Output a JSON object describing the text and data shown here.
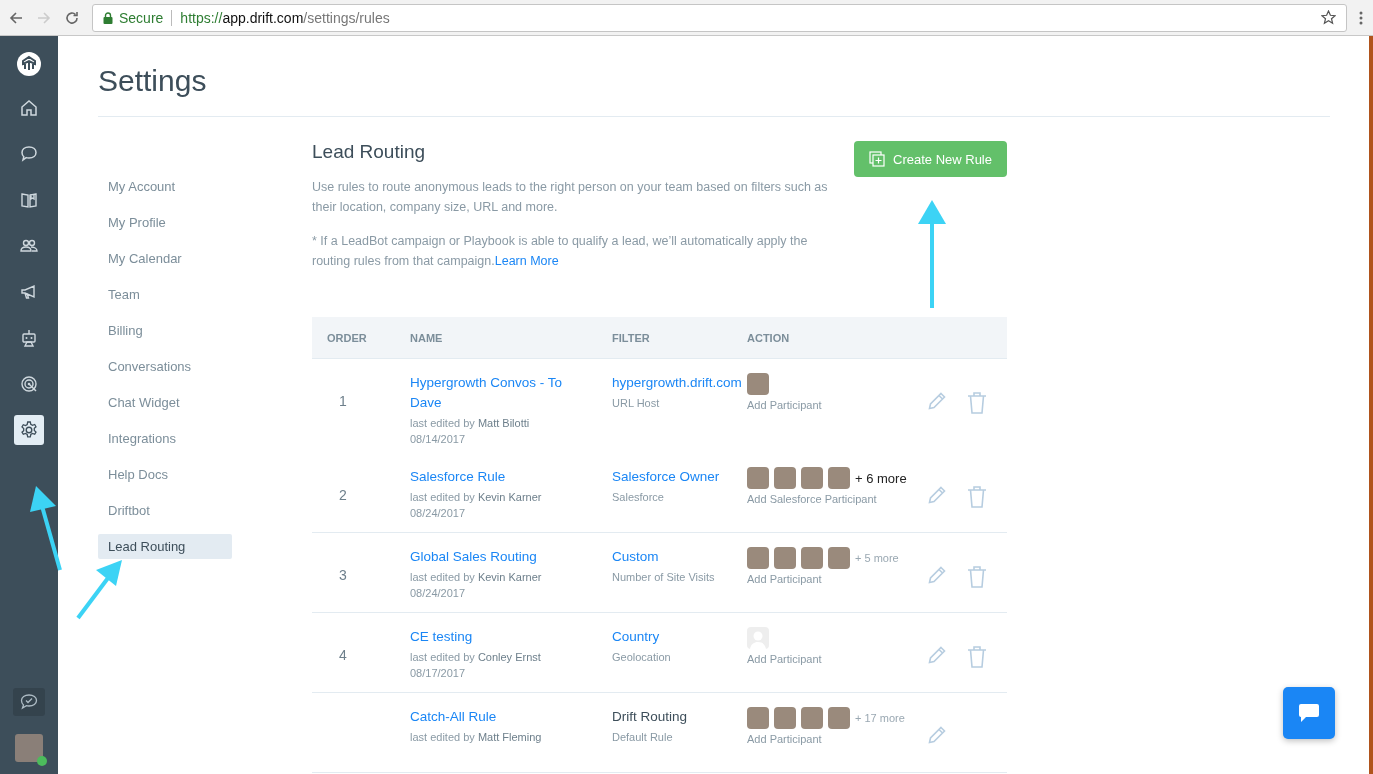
{
  "browser": {
    "back_disabled": false,
    "forward_disabled": true,
    "secure_label": "Secure",
    "url": {
      "scheme": "https://",
      "host": "app.drift.com",
      "path": "/settings/rules"
    }
  },
  "rail": {
    "items": [
      {
        "kind": "home",
        "selected": false
      },
      {
        "kind": "chat",
        "selected": false
      },
      {
        "kind": "book",
        "selected": false
      },
      {
        "kind": "people",
        "selected": false
      },
      {
        "kind": "megaphone",
        "selected": false
      },
      {
        "kind": "bot",
        "selected": false
      },
      {
        "kind": "target",
        "selected": false
      },
      {
        "kind": "settings",
        "selected": true
      }
    ],
    "user_online": true
  },
  "page_title": "Settings",
  "settings_nav": [
    {
      "label": "My Account",
      "selected": false
    },
    {
      "label": "My Profile",
      "selected": false
    },
    {
      "label": "My Calendar",
      "selected": false
    },
    {
      "label": "Team",
      "selected": false
    },
    {
      "label": "Billing",
      "selected": false
    },
    {
      "label": "Conversations",
      "selected": false
    },
    {
      "label": "Chat Widget",
      "selected": false
    },
    {
      "label": "Integrations",
      "selected": false
    },
    {
      "label": "Help Docs",
      "selected": false
    },
    {
      "label": "Driftbot",
      "selected": false
    },
    {
      "label": "Lead Routing",
      "selected": true
    }
  ],
  "section": {
    "title": "Lead Routing",
    "create_button": "Create New Rule",
    "description": "Use rules to route anonymous leads to the right person on your team based on filters such as their location, company size, URL and more.",
    "note": "* If a LeadBot campaign or Playbook is able to qualify a lead, we’ll automatically apply the routing rules from that campaign.",
    "note_link": "Learn More"
  },
  "table": {
    "columns": [
      "ORDER",
      "NAME",
      "FILTER",
      "ACTION"
    ],
    "rows": [
      {
        "order": "1",
        "name": "Hypergrowth Convos - To Dave",
        "edited_prefix": "last edited by",
        "editor": "Matt Bilotti",
        "date": "08/14/2017",
        "filter": "hypergrowth.drift.com",
        "filter_linked": true,
        "filter_type": "URL Host",
        "participants": [
          {
            "kind": "photo"
          }
        ],
        "add_label": "Add Participant",
        "deletable": true,
        "divided": false
      },
      {
        "order": "2",
        "name": "Salesforce Rule",
        "edited_prefix": "last edited by",
        "editor": "Kevin Karner",
        "date": "08/24/2017",
        "filter": "Salesforce Owner",
        "filter_linked": true,
        "filter_type": "Salesforce",
        "participants": [
          {
            "kind": "photo"
          },
          {
            "kind": "photo"
          },
          {
            "kind": "photo"
          },
          {
            "kind": "photo"
          }
        ],
        "more": "+ 6 more",
        "more_emphasized": true,
        "add_label": "Add Salesforce Participant",
        "deletable": true,
        "divided": true
      },
      {
        "order": "3",
        "name": "Global Sales Routing",
        "edited_prefix": "last edited by",
        "editor": "Kevin Karner",
        "date": "08/24/2017",
        "filter": "Custom",
        "filter_linked": true,
        "filter_type": "Number of Site Visits",
        "participants": [
          {
            "kind": "photo"
          },
          {
            "kind": "photo"
          },
          {
            "kind": "photo"
          },
          {
            "kind": "photo"
          }
        ],
        "more": "+ 5 more",
        "more_emphasized": false,
        "add_label": "Add Participant",
        "deletable": true,
        "divided": true
      },
      {
        "order": "4",
        "name": "CE testing",
        "edited_prefix": "last edited by",
        "editor": "Conley Ernst",
        "date": "08/17/2017",
        "filter": "Country",
        "filter_linked": true,
        "filter_type": "Geolocation",
        "participants": [
          {
            "kind": "blank"
          }
        ],
        "add_label": "Add Participant",
        "deletable": true,
        "divided": true
      },
      {
        "name": "Catch-All Rule",
        "edited_prefix": "last edited by",
        "editor": "Matt Fleming",
        "filter": "Drift Routing",
        "filter_linked": false,
        "filter_type": "Default Rule",
        "participants": [
          {
            "kind": "photo"
          },
          {
            "kind": "photo"
          },
          {
            "kind": "photo"
          },
          {
            "kind": "photo"
          }
        ],
        "more": "+ 17 more",
        "more_emphasized": false,
        "add_label": "Add Participant",
        "deletable": false,
        "divided": true
      }
    ]
  }
}
